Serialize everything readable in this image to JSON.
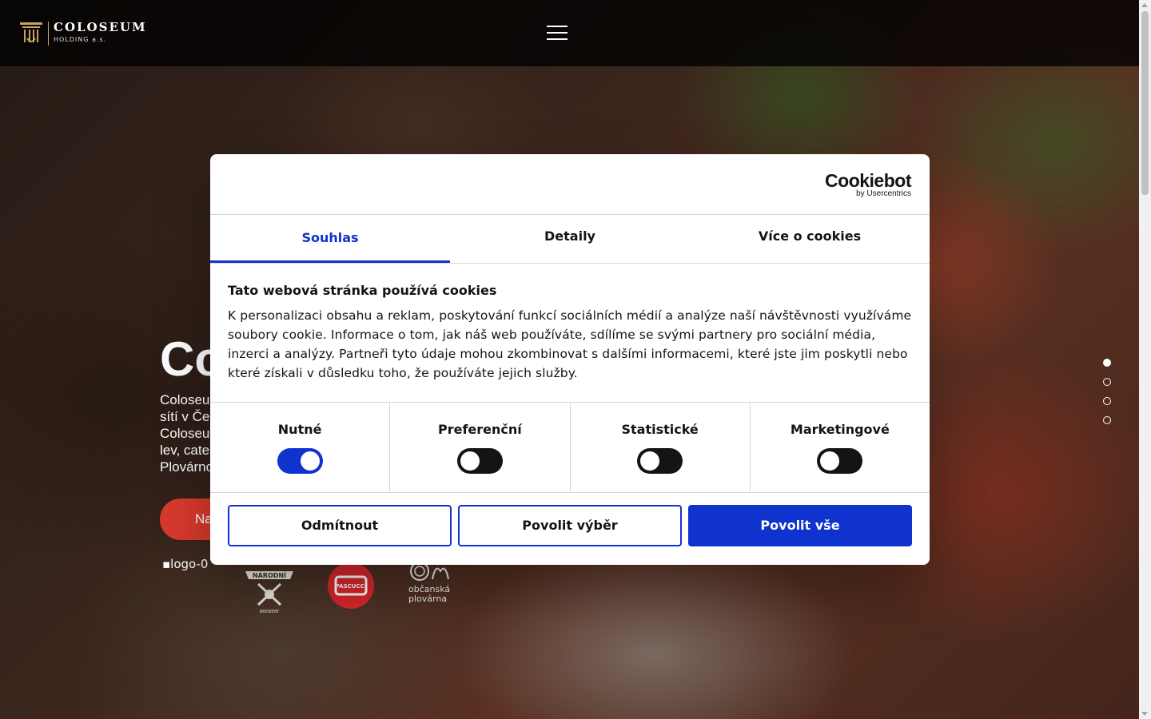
{
  "header": {
    "logo_name": "COLOSEUM",
    "logo_sub": "HOLDING a.s.",
    "menu_icon": "hamburger-icon"
  },
  "hero": {
    "title": "Co",
    "text_lines": [
      "Coloseu",
      "sítí v Če",
      "Coloseu",
      "lev, cate",
      "Plovárnc"
    ],
    "cta_label": "Na",
    "broken_logo_alt": "logo-0",
    "brand_narodni": "NÁRODNÍ",
    "brand_narodni_sub": "BREWERY",
    "brand_pascucci": "PASCUCCI",
    "brand_plovarna_line1": "občanská",
    "brand_plovarna_line2": "plovárna",
    "slides": 4,
    "active_slide": 1
  },
  "dialog": {
    "brand_name": "Cookiebot",
    "brand_by": "by Usercentrics",
    "tabs": [
      "Souhlas",
      "Detaily",
      "Více o cookies"
    ],
    "active_tab": "Souhlas",
    "title": "Tato webová stránka používá cookies",
    "text": "K personalizaci obsahu a reklam, poskytování funkcí sociálních médií a analýze naší návštěvnosti využíváme soubory cookie. Informace o tom, jak náš web používáte, sdílíme se svými partnery pro sociální média, inzerci a analýzy. Partneři tyto údaje mohou zkombinovat s dalšími informacemi, které jste jim poskytli nebo které získali v důsledku toho, že používáte jejich služby.",
    "categories": [
      {
        "label": "Nutné",
        "on": true
      },
      {
        "label": "Preferenční",
        "on": false
      },
      {
        "label": "Statistické",
        "on": false
      },
      {
        "label": "Marketingové",
        "on": false
      }
    ],
    "buttons": {
      "deny": "Odmítnout",
      "allow_selection": "Povolit výběr",
      "allow_all": "Povolit vše"
    }
  },
  "colors": {
    "accent": "#1032cf",
    "cta": "#d93a2c",
    "logo_gold": "#c9a26a"
  }
}
